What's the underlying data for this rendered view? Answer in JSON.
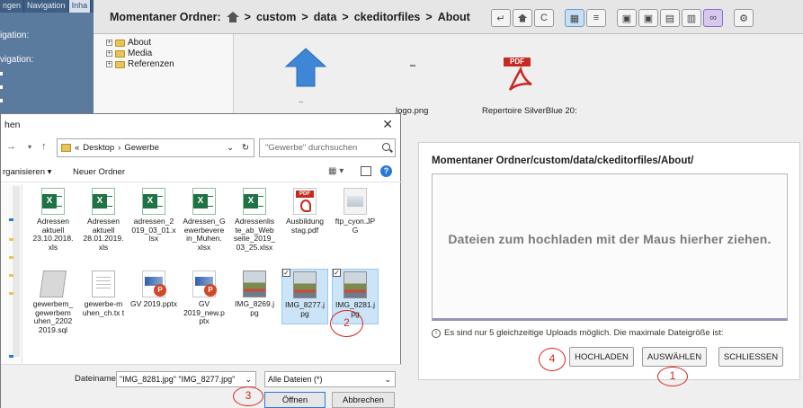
{
  "file_manager": {
    "tabs": [
      "ngen",
      "Navigation",
      "Inha"
    ],
    "side_labels": [
      "igation:",
      "vigation:"
    ],
    "breadcrumb": {
      "label": "Momentaner Ordner:",
      "path": [
        "custom",
        "data",
        "ckeditorfiles",
        "About"
      ],
      "separator": ">"
    },
    "tree": [
      "About",
      "Media",
      "Referenzen"
    ],
    "files": [
      "..",
      "logo.png",
      "Repertoire SilverBlue 20:"
    ]
  },
  "dialog": {
    "title": "hen",
    "path": [
      "«",
      "Desktop",
      "Gewerbe"
    ],
    "search_placeholder": "\"Gewerbe\" durchsuchen",
    "toolbar": {
      "organize": "rganisieren ▾",
      "new_folder": "Neuer Ordner"
    },
    "files": [
      {
        "name": "Adressen aktuell 23.10.2018. xls",
        "icon": "excel-icon"
      },
      {
        "name": "Adressen aktuell 28.01.2019. xls",
        "icon": "excel-icon"
      },
      {
        "name": "adressen_2 019_03_01.x lsx",
        "icon": "excel-icon"
      },
      {
        "name": "Adressen_G ewerbevere in_Muhen. xlsx",
        "icon": "excel-icon"
      },
      {
        "name": "Adressenlis te_ab_Web seite_2019_ 03_25.xlsx",
        "icon": "excel-icon"
      },
      {
        "name": "Ausbildung stag.pdf",
        "icon": "pdf-icon"
      },
      {
        "name": "ftp_cyon.JP G",
        "icon": "image-icon"
      },
      {
        "name": "gewerbem_ gewerbem uhen_2202 2019.sql",
        "icon": "sql-icon"
      },
      {
        "name": "gewerbe-m uhen_ch.tx t",
        "icon": "text-icon"
      },
      {
        "name": "GV 2019.pptx",
        "icon": "powerpoint-icon"
      },
      {
        "name": "GV 2019_new.p ptx",
        "icon": "powerpoint-icon"
      },
      {
        "name": "IMG_8269.j pg",
        "icon": "photo-icon"
      },
      {
        "name": "IMG_8277.j pg",
        "icon": "photo-icon",
        "selected": true
      },
      {
        "name": "IMG_8281.j pg",
        "icon": "photo-icon",
        "selected": true
      }
    ],
    "filename_label": "Dateiname:",
    "filename_value": "\"IMG_8281.jpg\" \"IMG_8277.jpg\"",
    "filetype_value": "Alle Dateien (*)",
    "open_button": "Öffnen",
    "cancel_button": "Abbrechen"
  },
  "upload_panel": {
    "title": "Momentaner Ordner/custom/data/ckeditorfiles/About/",
    "drop_text": "Dateien zum hochladen mit der Maus hierher ziehen.",
    "info_text": "Es sind nur 5 gleichzeitige Uploads möglich. Die maximale Dateigröße ist:",
    "buttons": {
      "upload": "HOCHLADEN",
      "select": "AUSWÄHLEN",
      "close": "SCHLIESSEN"
    }
  },
  "annotations": [
    "1",
    "2",
    "3",
    "4"
  ],
  "colors": {
    "annotation": "#d7261e",
    "accent": "#2b79d6",
    "drop_border": "#9b8fc2"
  }
}
